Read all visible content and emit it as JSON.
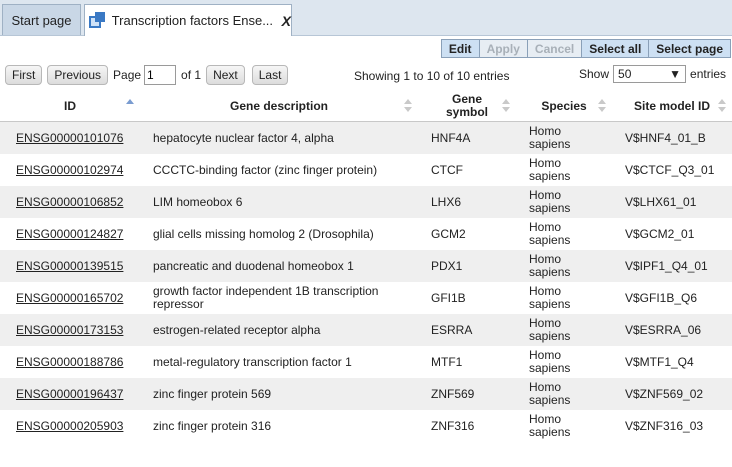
{
  "tabs": {
    "start": "Start page",
    "active": "Transcription factors Ense...",
    "close": "X"
  },
  "toolbar": {
    "edit": "Edit",
    "apply": "Apply",
    "cancel": "Cancel",
    "select_all": "Select all",
    "select_page": "Select page"
  },
  "pager": {
    "first": "First",
    "previous": "Previous",
    "page_label": "Page",
    "page_value": "1",
    "of_label": "of 1",
    "next": "Next",
    "last": "Last",
    "showing": "Showing 1 to 10 of 10 entries",
    "show_label": "Show",
    "show_value": "50",
    "entries_label": "entries"
  },
  "table": {
    "columns": {
      "id": "ID",
      "description": "Gene description",
      "symbol": "Gene symbol",
      "species": "Species",
      "site": "Site model ID"
    },
    "rows": [
      {
        "id": "ENSG00000101076",
        "desc": "hepatocyte nuclear factor 4, alpha",
        "sym": "HNF4A",
        "spec": "Homo sapiens",
        "site": "V$HNF4_01_B"
      },
      {
        "id": "ENSG00000102974",
        "desc": "CCCTC-binding factor (zinc finger protein)",
        "sym": "CTCF",
        "spec": "Homo sapiens",
        "site": "V$CTCF_Q3_01"
      },
      {
        "id": "ENSG00000106852",
        "desc": "LIM homeobox 6",
        "sym": "LHX6",
        "spec": "Homo sapiens",
        "site": "V$LHX61_01"
      },
      {
        "id": "ENSG00000124827",
        "desc": "glial cells missing homolog 2 (Drosophila)",
        "sym": "GCM2",
        "spec": "Homo sapiens",
        "site": "V$GCM2_01"
      },
      {
        "id": "ENSG00000139515",
        "desc": "pancreatic and duodenal homeobox 1",
        "sym": "PDX1",
        "spec": "Homo sapiens",
        "site": "V$IPF1_Q4_01"
      },
      {
        "id": "ENSG00000165702",
        "desc": "growth factor independent 1B transcription repressor",
        "sym": "GFI1B",
        "spec": "Homo sapiens",
        "site": "V$GFI1B_Q6"
      },
      {
        "id": "ENSG00000173153",
        "desc": "estrogen-related receptor alpha",
        "sym": "ESRRA",
        "spec": "Homo sapiens",
        "site": "V$ESRRA_06"
      },
      {
        "id": "ENSG00000188786",
        "desc": "metal-regulatory transcription factor 1",
        "sym": "MTF1",
        "spec": "Homo sapiens",
        "site": "V$MTF1_Q4"
      },
      {
        "id": "ENSG00000196437",
        "desc": "zinc finger protein 569",
        "sym": "ZNF569",
        "spec": "Homo sapiens",
        "site": "V$ZNF569_02"
      },
      {
        "id": "ENSG00000205903",
        "desc": "zinc finger protein 316",
        "sym": "ZNF316",
        "spec": "Homo sapiens",
        "site": "V$ZNF316_03"
      }
    ]
  }
}
